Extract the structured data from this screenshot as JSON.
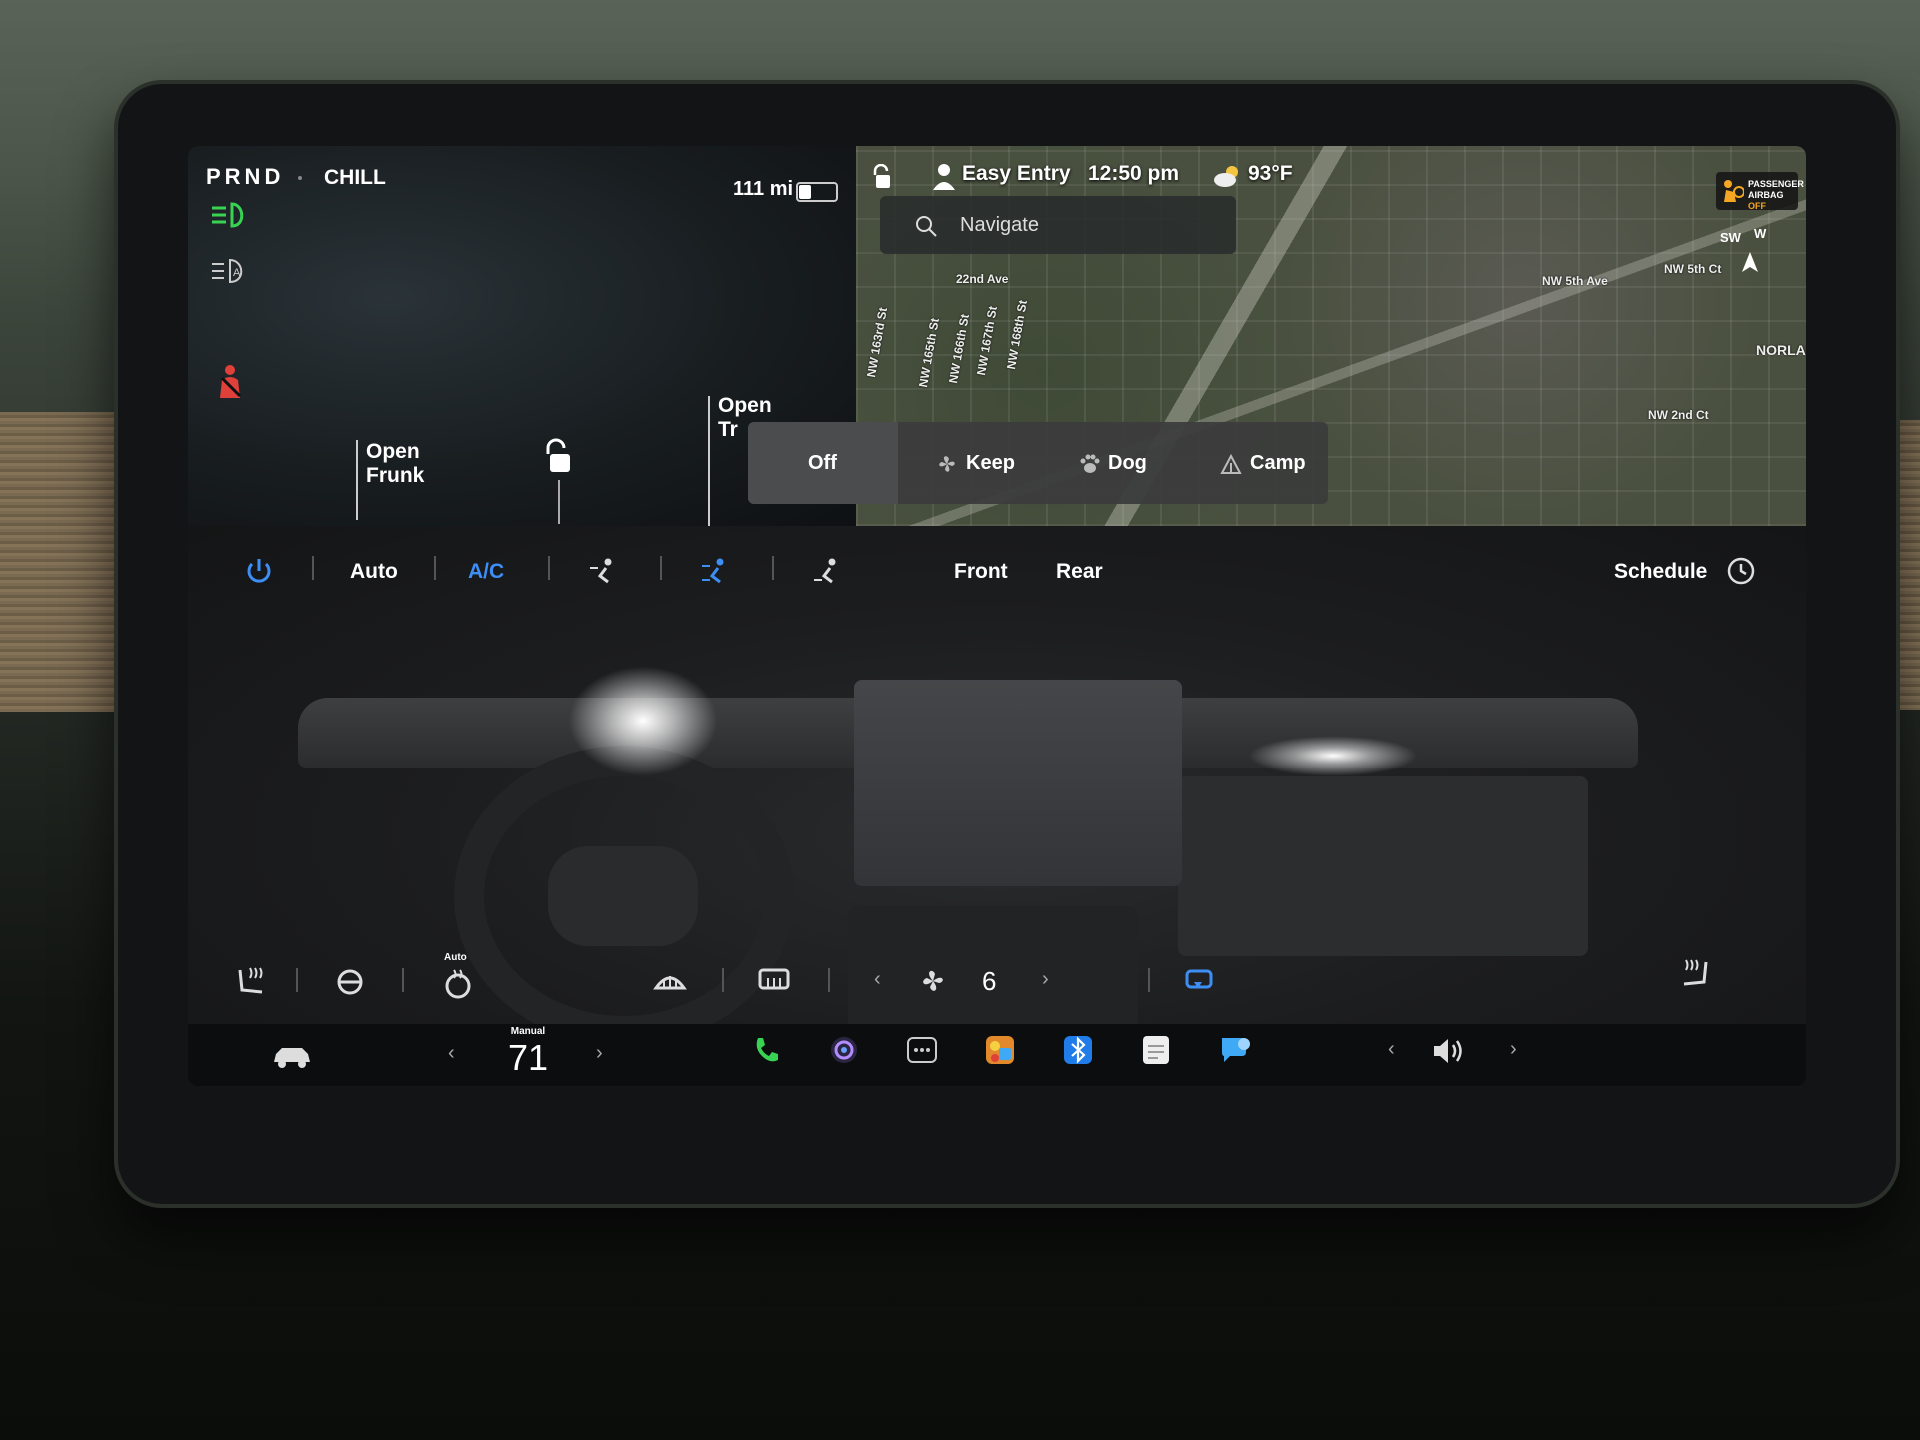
{
  "status": {
    "gear": "PRND",
    "drive_mode": "CHILL",
    "range": "111 mi",
    "battery_level": 0.3
  },
  "vehicle": {
    "open_frunk": "Open\nFrunk",
    "open_trunk": "Open\nTr"
  },
  "map": {
    "profile": "Easy Entry",
    "time": "12:50 pm",
    "temperature": "93°F",
    "navigate_placeholder": "Navigate",
    "airbag_line1": "PASSENGER",
    "airbag_line2": "AIRBAG",
    "airbag_state": "OFF",
    "compass_sw": "SW",
    "compass_w": "W",
    "streets": [
      "NW 5th Ave",
      "NW 5th Ct",
      "NW 2nd Ct",
      "NORLAN",
      "22nd Ave",
      "NW 163rd St",
      "NW 165th St",
      "NW 166th St",
      "NW 167th St",
      "NW 168th St"
    ]
  },
  "keep_modes": {
    "off": "Off",
    "keep": "Keep",
    "dog": "Dog",
    "camp": "Camp"
  },
  "climate": {
    "auto": "Auto",
    "ac": "A/C",
    "front": "Front",
    "rear": "Rear",
    "schedule": "Schedule",
    "seat_auto": "Auto",
    "fan_speed": "6"
  },
  "dock": {
    "temp_mode": "Manual",
    "temp_value": "71"
  },
  "colors": {
    "accent_blue": "#3d8ef5",
    "headlight_green": "#39d353",
    "seatbelt_red": "#e0403a",
    "airbag_orange": "#f5a623"
  }
}
